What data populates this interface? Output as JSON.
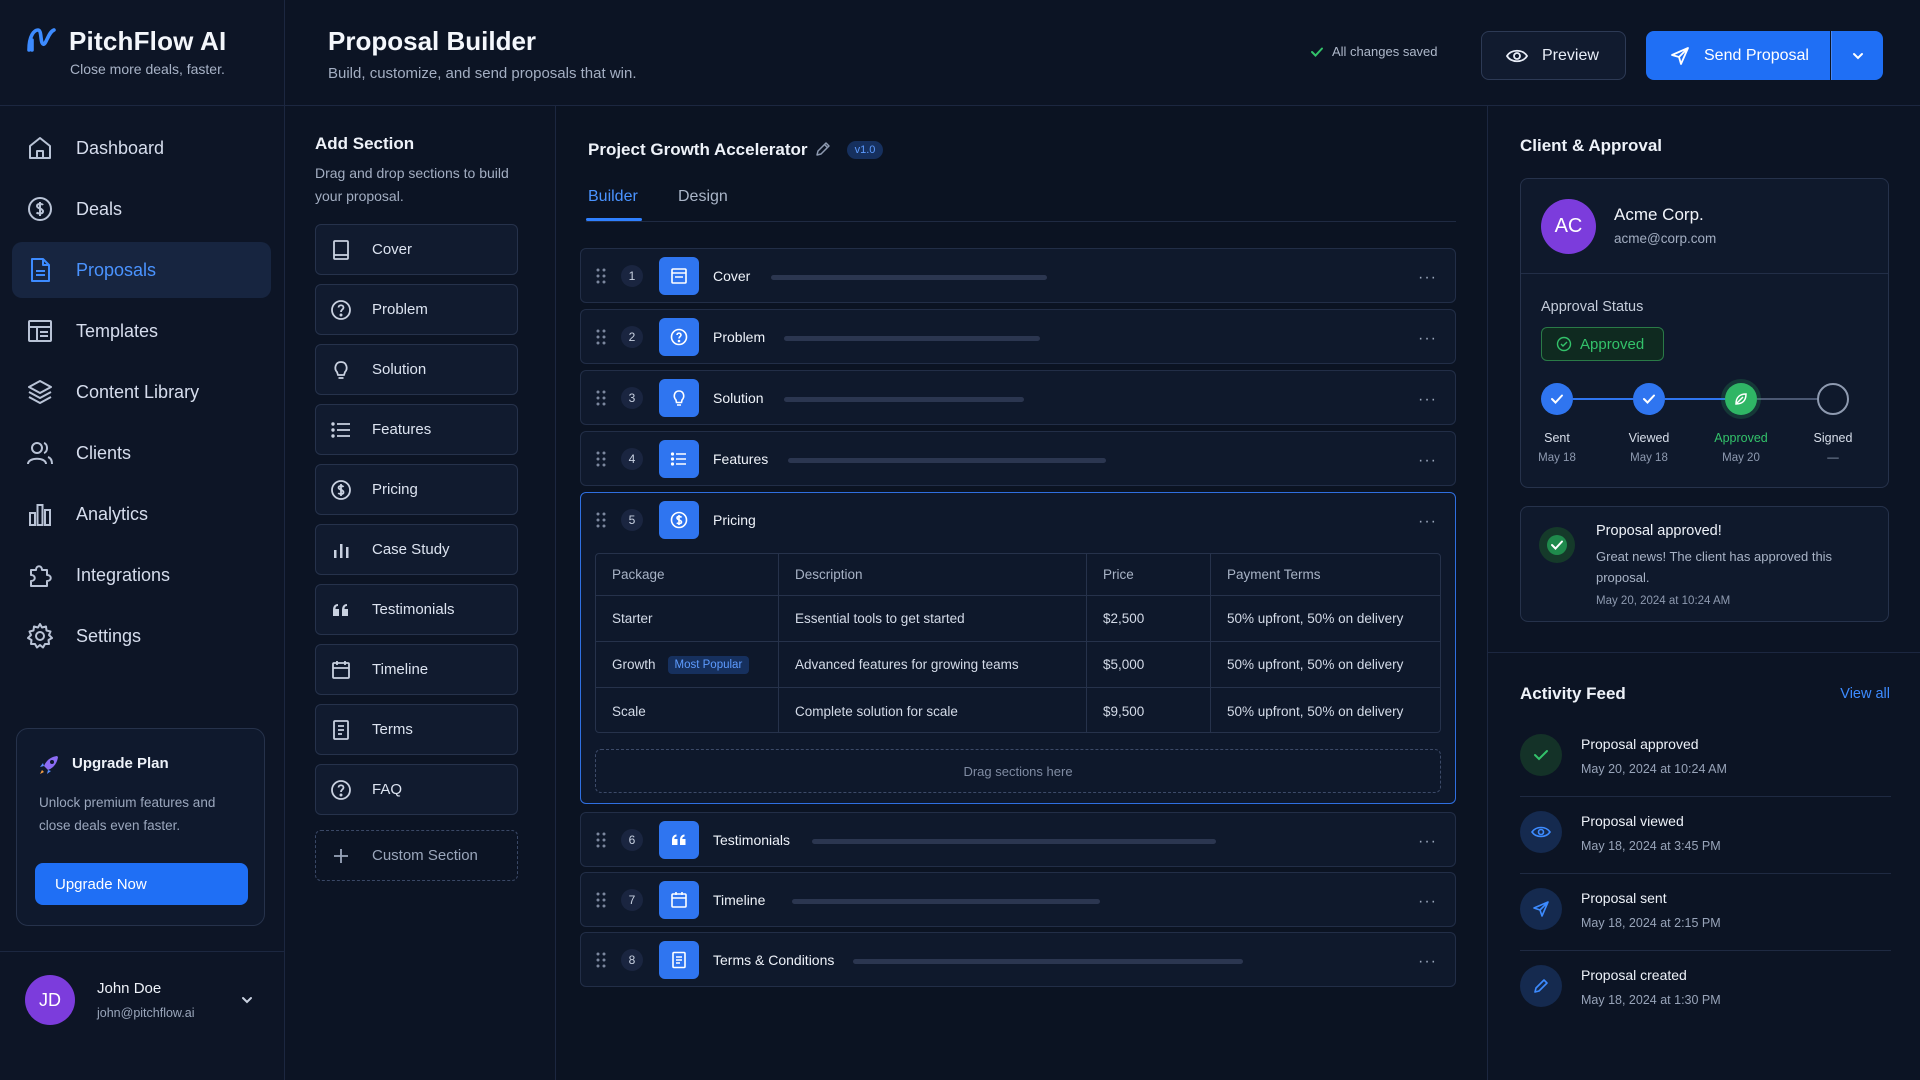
{
  "brand": {
    "name": "PitchFlow AI",
    "tagline": "Close more deals, faster."
  },
  "nav": [
    {
      "label": "Dashboard",
      "icon": "home-icon"
    },
    {
      "label": "Deals",
      "icon": "dollar-icon"
    },
    {
      "label": "Proposals",
      "icon": "document-icon",
      "active": true
    },
    {
      "label": "Templates",
      "icon": "template-icon"
    },
    {
      "label": "Content Library",
      "icon": "layers-icon"
    },
    {
      "label": "Clients",
      "icon": "users-icon"
    },
    {
      "label": "Analytics",
      "icon": "bar-chart-icon"
    },
    {
      "label": "Integrations",
      "icon": "puzzle-icon"
    },
    {
      "label": "Settings",
      "icon": "gear-icon"
    }
  ],
  "upgrade": {
    "title": "Upgrade Plan",
    "desc": "Unlock premium features and close deals even faster.",
    "button": "Upgrade Now"
  },
  "user": {
    "initials": "JD",
    "name": "John Doe",
    "email": "john@pitchflow.ai"
  },
  "header": {
    "title": "Proposal Builder",
    "subtitle": "Build, customize, and send proposals that win.",
    "saved": "All changes saved",
    "preview": "Preview",
    "send": "Send Proposal"
  },
  "add_section": {
    "title": "Add Section",
    "desc": "Drag and drop sections to build your proposal.",
    "items": [
      "Cover",
      "Problem",
      "Solution",
      "Features",
      "Pricing",
      "Case Study",
      "Testimonials",
      "Timeline",
      "Terms",
      "FAQ"
    ],
    "custom": "Custom Section"
  },
  "builder": {
    "project": "Project Growth Accelerator",
    "version": "v1.0",
    "tabs": [
      "Builder",
      "Design"
    ],
    "sections": [
      {
        "num": "1",
        "name": "Cover"
      },
      {
        "num": "2",
        "name": "Problem"
      },
      {
        "num": "3",
        "name": "Solution"
      },
      {
        "num": "4",
        "name": "Features"
      },
      {
        "num": "5",
        "name": "Pricing"
      },
      {
        "num": "6",
        "name": "Testimonials"
      },
      {
        "num": "7",
        "name": "Timeline"
      },
      {
        "num": "8",
        "name": "Terms & Conditions"
      }
    ],
    "pricing": {
      "headers": [
        "Package",
        "Description",
        "Price",
        "Payment Terms"
      ],
      "rows": [
        {
          "package": "Starter",
          "desc": "Essential tools to get started",
          "price": "$2,500",
          "terms": "50% upfront, 50% on delivery"
        },
        {
          "package": "Growth",
          "badge": "Most Popular",
          "desc": "Advanced features for growing teams",
          "price": "$5,000",
          "terms": "50% upfront, 50% on delivery"
        },
        {
          "package": "Scale",
          "desc": "Complete solution for scale",
          "price": "$9,500",
          "terms": "50% upfront, 50% on delivery"
        }
      ],
      "dropzone": "Drag sections here"
    }
  },
  "client": {
    "panel_title": "Client & Approval",
    "initials": "AC",
    "name": "Acme Corp.",
    "email": "acme@corp.com",
    "approval_label": "Approval Status",
    "approval_status": "Approved",
    "steps": [
      {
        "name": "Sent",
        "date": "May 18"
      },
      {
        "name": "Viewed",
        "date": "May 18"
      },
      {
        "name": "Approved",
        "date": "May 20"
      },
      {
        "name": "Signed",
        "date": "—"
      }
    ],
    "notification": {
      "title": "Proposal approved!",
      "desc": "Great news! The client has approved this proposal.",
      "date": "May 20, 2024 at 10:24 AM"
    }
  },
  "activity": {
    "title": "Activity Feed",
    "view_all": "View all",
    "items": [
      {
        "title": "Proposal approved",
        "date": "May 20, 2024 at 10:24 AM"
      },
      {
        "title": "Proposal viewed",
        "date": "May 18, 2024 at 3:45 PM"
      },
      {
        "title": "Proposal sent",
        "date": "May 18, 2024 at 2:15 PM"
      },
      {
        "title": "Proposal created",
        "date": "May 18, 2024 at 1:30 PM"
      }
    ]
  },
  "colors": {
    "accent": "#1f6ff5",
    "success": "#33c26a",
    "avatar": "#7c3cdc",
    "background": "#0b1322"
  }
}
